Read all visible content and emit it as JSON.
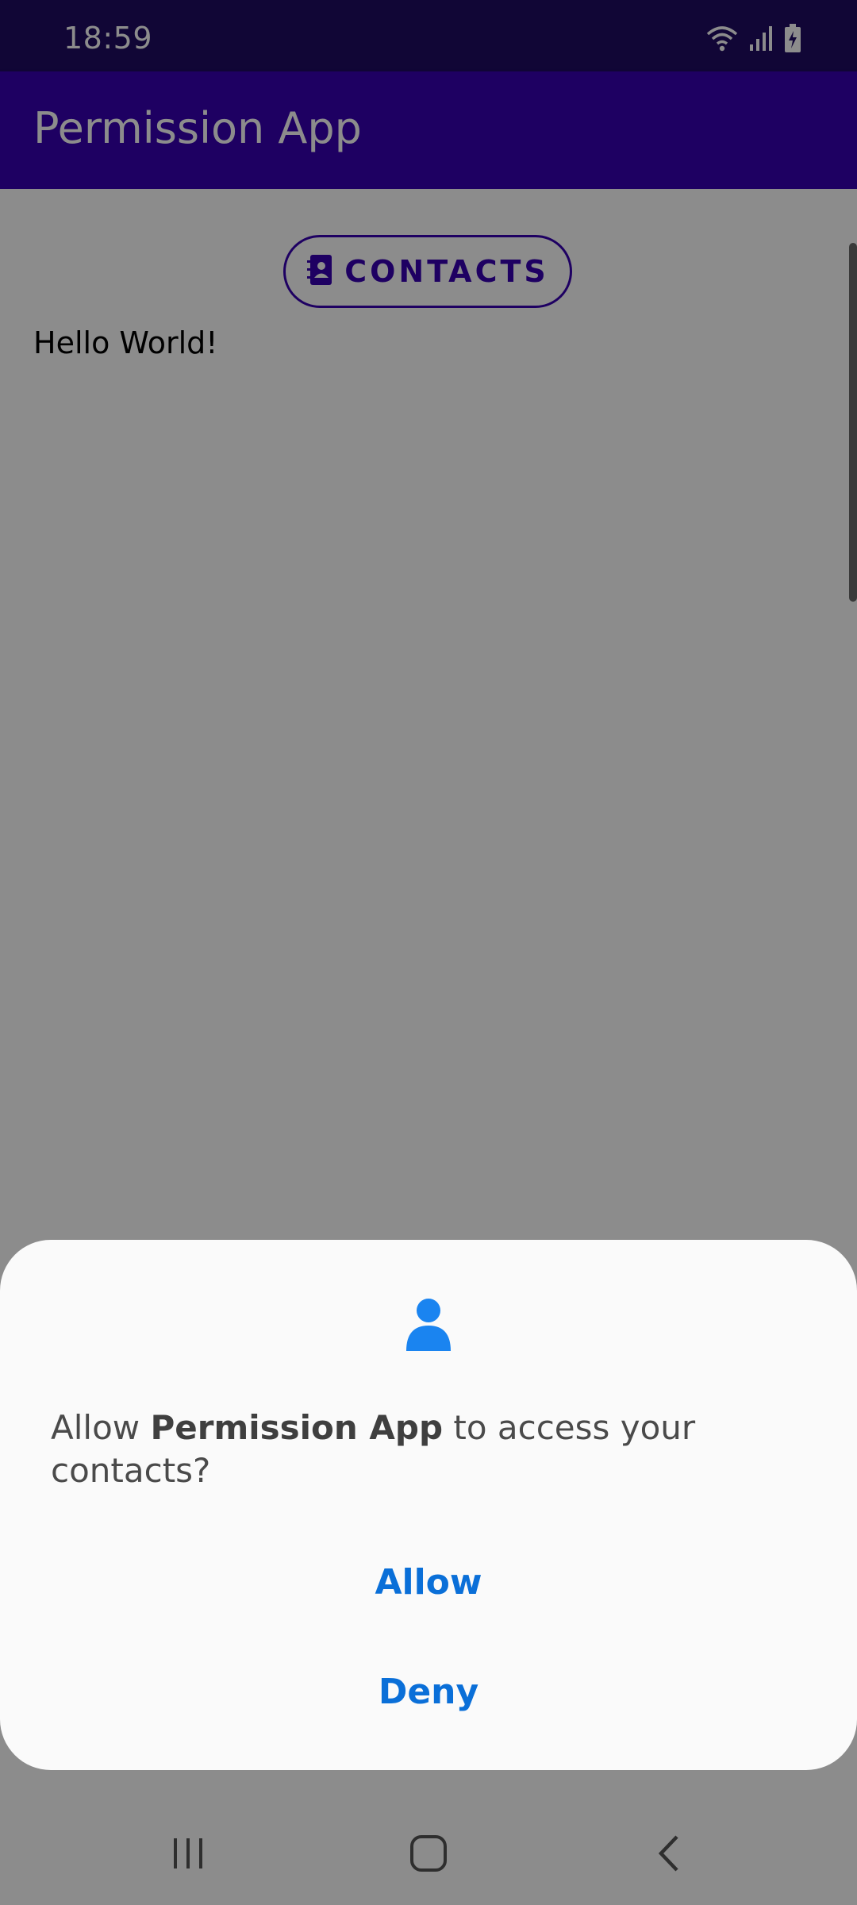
{
  "status_bar": {
    "time": "18:59",
    "icons": [
      "wifi-icon",
      "signal-icon",
      "battery-charging-icon"
    ]
  },
  "app_bar": {
    "title": "Permission App"
  },
  "content": {
    "contacts_button": {
      "label": "CONTACTS",
      "icon": "contacts-book-icon"
    },
    "hello_text": "Hello World!"
  },
  "dialog": {
    "icon": "person-icon",
    "message_prefix": "Allow ",
    "app_name": "Permission App",
    "message_suffix": " to access your contacts?",
    "allow_label": "Allow",
    "deny_label": "Deny"
  },
  "nav_bar": {
    "buttons": [
      "recents-icon",
      "home-icon",
      "back-icon"
    ]
  },
  "colors": {
    "status_bar": "#1f0b63",
    "app_bar": "#3700b3",
    "accent": "#3700b3",
    "dialog_action": "#0a6fd8",
    "dialog_icon": "#1a84f0"
  }
}
